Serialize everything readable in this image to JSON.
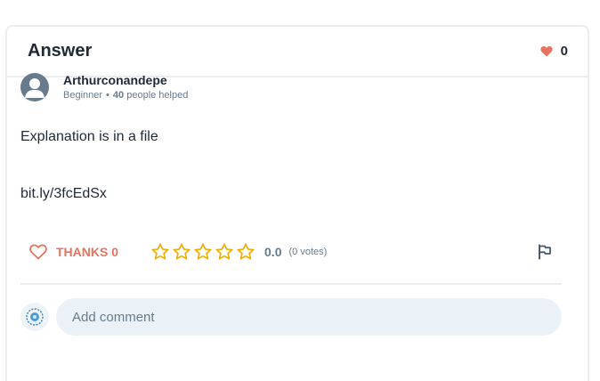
{
  "card": {
    "title": "Answer",
    "likes_count": "0"
  },
  "author": {
    "name": "Arthurconandepe",
    "rank": "Beginner",
    "separator": "•",
    "helped_count": "40",
    "helped_label": "people helped"
  },
  "answer": {
    "paragraphs": [
      "Explanation is in a file",
      "bit.ly/3fcEdSx"
    ]
  },
  "actions": {
    "thanks_label": "THANKS 0",
    "rating_value": "0.0",
    "votes_text": "(0 votes)",
    "stars_filled": 0,
    "stars_total": 5
  },
  "comment": {
    "placeholder": "Add comment"
  },
  "icons": {
    "likes": "heart-icon",
    "thanks": "heart-outline-icon",
    "star": "star-outline-icon",
    "report": "flag-icon",
    "avatar": "user-silhouette-icon"
  },
  "colors": {
    "accent": "#e8725e",
    "star": "#f0ad00",
    "text": "#1f2a36",
    "muted": "#687b8c"
  }
}
